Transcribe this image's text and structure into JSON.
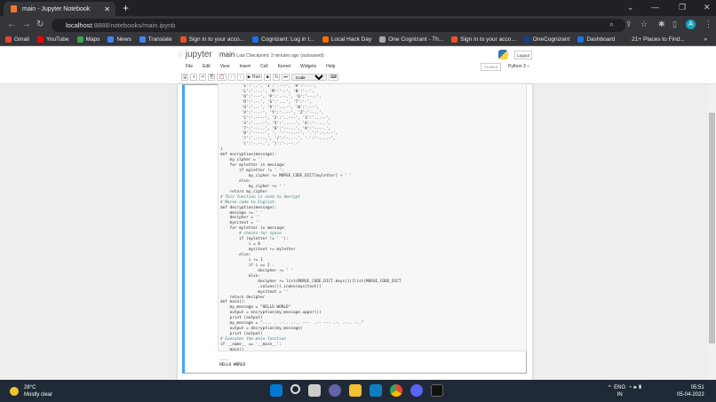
{
  "browser": {
    "tab_title": "main - Jupyter Notebook",
    "url_host": "localhost",
    "url_path": ":8888/notebooks/main.ipynb",
    "bookmarks": [
      {
        "label": "Gmail",
        "color": "#ea4335"
      },
      {
        "label": "YouTube",
        "color": "#ff0000"
      },
      {
        "label": "Maps",
        "color": "#34a853"
      },
      {
        "label": "News",
        "color": "#4285f4"
      },
      {
        "label": "Translate",
        "color": "#4285f4"
      },
      {
        "label": "Sign in to your acco...",
        "color": "#f25022"
      },
      {
        "label": "Cognizant: Log in t...",
        "color": "#1a73e8"
      },
      {
        "label": "Local Hack Day",
        "color": "#ff6d00"
      },
      {
        "label": "One Cognizant - Th...",
        "color": "#aaaaaa"
      },
      {
        "label": "Sign in to your acco...",
        "color": "#f25022"
      },
      {
        "label": "OneCognizant",
        "color": "#1a3c8b"
      },
      {
        "label": "Dashboard",
        "color": "#1a73e8"
      },
      {
        "label": "21+ Places to Find...",
        "color": "#333333"
      }
    ],
    "more": "»",
    "avatar": "A"
  },
  "jupyter": {
    "logo": "jupyter",
    "notebook_name": "main",
    "checkpoint": "Last Checkpoint: 3 minutes ago",
    "autosaved": "(autosaved)",
    "logout": "Logout",
    "menu": [
      "File",
      "Edit",
      "View",
      "Insert",
      "Cell",
      "Kernel",
      "Widgets",
      "Help"
    ],
    "trusted": "Trusted",
    "kernel": "Python 3",
    "run": "▶ Run",
    "cell_type": "Code"
  },
  "code_lines": [
    "         'I':'..', 'J':'.---', 'K':'-.-',",
    "         'L':'.-..', 'M':'--', 'N':'-.',",
    "         'O':'---', 'P':'.--.', 'Q':'--.-',",
    "         'R':'.-.', 'S':'...', 'T':'-',",
    "         'U':'..-', 'V':'...-', 'W':'.--',",
    "         'X':'-..-', 'Y':'-.--', 'Z':'--..',",
    "         '1':'.----', '2':'..---', '3':'...--',",
    "         '4':'....-', '5':'.....', '6':'-....',",
    "         '7':'--...', '8':'---..', '9':'----.',",
    "         '0':'-----', ', ':'--..--', '.':'.-.-.-',",
    "         '?':'..--..', '/':'-..-.', '-':'-....-',",
    "         '(':'-.--.', ')':'-.--.-'",
    "}",
    "def encryption(message):",
    "    my_cipher = ''",
    "    for myletter in message:",
    "        if myletter != ' ':",
    "            my_cipher += MORSE_CODE_DICT[myletter] + ' '",
    "        else:",
    "            my_cipher += ' '",
    "    return my_cipher",
    "# This function is used to decrypt",
    "# Morse code to English",
    "def decryption(message):",
    "    message += ' '",
    "    decipher = ''",
    "    mycitext = ''",
    "    for myletter in message:",
    "        # checks for space",
    "        if (myletter != ' '):",
    "            i = 0",
    "            mycitext += myletter",
    "        else:",
    "            i += 1",
    "            if i == 2 :",
    "                decipher += ' '",
    "            else:",
    "                decipher += list(MORSE_CODE_DICT.keys())[list(MORSE_CODE_DICT",
    "                .values()).index(mycitext)]",
    "                mycitext = ''",
    "    return decipher",
    "def main():",
    "    my_message = \"HELLO WORLD\"",
    "    output = encryption(my_message.upper())",
    "    print (output)",
    "    my_message = \".... . .-.. .-.. ---  .-- --- .-. .-.. -..\"",
    "    output = decryption(my_message)",
    "    print (output)",
    "# Executes the main function",
    "if __name__ == '__main__':",
    "    main()"
  ],
  "output_lines": [
    "....",
    "HELLO WORLD"
  ],
  "taskbar": {
    "temp": "28°C",
    "weather": "Mostly clear",
    "lang1": "ENG",
    "lang2": "IN",
    "time": "05:51",
    "date": "05-04-2022"
  }
}
